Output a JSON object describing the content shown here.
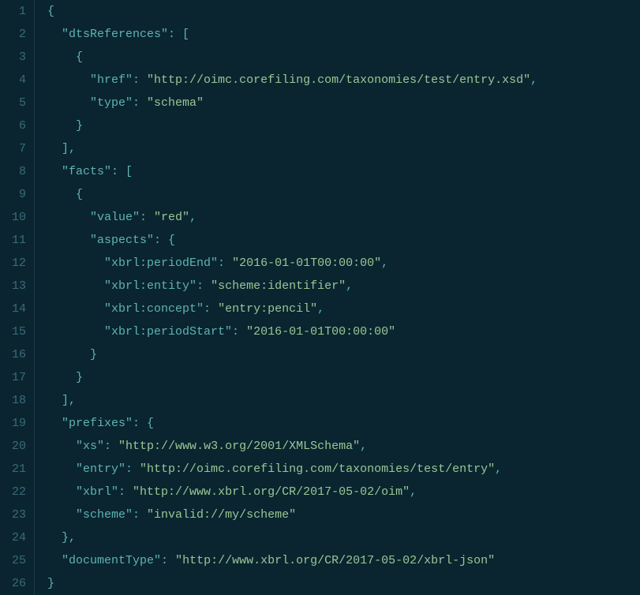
{
  "lineCount": 26,
  "code": {
    "dtsReferences": [
      {
        "href": "http://oimc.corefiling.com/taxonomies/test/entry.xsd",
        "type": "schema"
      }
    ],
    "facts": [
      {
        "value": "red",
        "aspects": {
          "xbrl:periodEnd": "2016-01-01T00:00:00",
          "xbrl:entity": "scheme:identifier",
          "xbrl:concept": "entry:pencil",
          "xbrl:periodStart": "2016-01-01T00:00:00"
        }
      }
    ],
    "prefixes": {
      "xs": "http://www.w3.org/2001/XMLSchema",
      "entry": "http://oimc.corefiling.com/taxonomies/test/entry",
      "xbrl": "http://www.xbrl.org/CR/2017-05-02/oim",
      "scheme": "invalid://my/scheme"
    },
    "documentType": "http://www.xbrl.org/CR/2017-05-02/xbrl-json"
  },
  "tokens": [
    [
      {
        "t": "punct",
        "v": "{"
      }
    ],
    [
      {
        "t": "ind",
        "v": "  "
      },
      {
        "t": "key",
        "v": "\"dtsReferences\""
      },
      {
        "t": "punct",
        "v": ": ["
      }
    ],
    [
      {
        "t": "ind",
        "v": "    "
      },
      {
        "t": "punct",
        "v": "{"
      }
    ],
    [
      {
        "t": "ind",
        "v": "      "
      },
      {
        "t": "key",
        "v": "\"href\""
      },
      {
        "t": "punct",
        "v": ": "
      },
      {
        "t": "str",
        "v": "\"http://oimc.corefiling.com/taxonomies/test/entry.xsd\""
      },
      {
        "t": "punct",
        "v": ","
      }
    ],
    [
      {
        "t": "ind",
        "v": "      "
      },
      {
        "t": "key",
        "v": "\"type\""
      },
      {
        "t": "punct",
        "v": ": "
      },
      {
        "t": "str",
        "v": "\"schema\""
      }
    ],
    [
      {
        "t": "ind",
        "v": "    "
      },
      {
        "t": "punct",
        "v": "}"
      }
    ],
    [
      {
        "t": "ind",
        "v": "  "
      },
      {
        "t": "punct",
        "v": "],"
      }
    ],
    [
      {
        "t": "ind",
        "v": "  "
      },
      {
        "t": "key",
        "v": "\"facts\""
      },
      {
        "t": "punct",
        "v": ": ["
      }
    ],
    [
      {
        "t": "ind",
        "v": "    "
      },
      {
        "t": "punct",
        "v": "{"
      }
    ],
    [
      {
        "t": "ind",
        "v": "      "
      },
      {
        "t": "key",
        "v": "\"value\""
      },
      {
        "t": "punct",
        "v": ": "
      },
      {
        "t": "str",
        "v": "\"red\""
      },
      {
        "t": "punct",
        "v": ","
      }
    ],
    [
      {
        "t": "ind",
        "v": "      "
      },
      {
        "t": "key",
        "v": "\"aspects\""
      },
      {
        "t": "punct",
        "v": ": {"
      }
    ],
    [
      {
        "t": "ind",
        "v": "        "
      },
      {
        "t": "key",
        "v": "\"xbrl:periodEnd\""
      },
      {
        "t": "punct",
        "v": ": "
      },
      {
        "t": "str",
        "v": "\"2016-01-01T00:00:00\""
      },
      {
        "t": "punct",
        "v": ","
      }
    ],
    [
      {
        "t": "ind",
        "v": "        "
      },
      {
        "t": "key",
        "v": "\"xbrl:entity\""
      },
      {
        "t": "punct",
        "v": ": "
      },
      {
        "t": "str",
        "v": "\"scheme:identifier\""
      },
      {
        "t": "punct",
        "v": ","
      }
    ],
    [
      {
        "t": "ind",
        "v": "        "
      },
      {
        "t": "key",
        "v": "\"xbrl:concept\""
      },
      {
        "t": "punct",
        "v": ": "
      },
      {
        "t": "str",
        "v": "\"entry:pencil\""
      },
      {
        "t": "punct",
        "v": ","
      }
    ],
    [
      {
        "t": "ind",
        "v": "        "
      },
      {
        "t": "key",
        "v": "\"xbrl:periodStart\""
      },
      {
        "t": "punct",
        "v": ": "
      },
      {
        "t": "str",
        "v": "\"2016-01-01T00:00:00\""
      }
    ],
    [
      {
        "t": "ind",
        "v": "      "
      },
      {
        "t": "punct",
        "v": "}"
      }
    ],
    [
      {
        "t": "ind",
        "v": "    "
      },
      {
        "t": "punct",
        "v": "}"
      }
    ],
    [
      {
        "t": "ind",
        "v": "  "
      },
      {
        "t": "punct",
        "v": "],"
      }
    ],
    [
      {
        "t": "ind",
        "v": "  "
      },
      {
        "t": "key",
        "v": "\"prefixes\""
      },
      {
        "t": "punct",
        "v": ": {"
      }
    ],
    [
      {
        "t": "ind",
        "v": "    "
      },
      {
        "t": "key",
        "v": "\"xs\""
      },
      {
        "t": "punct",
        "v": ": "
      },
      {
        "t": "str",
        "v": "\"http://www.w3.org/2001/XMLSchema\""
      },
      {
        "t": "punct",
        "v": ","
      }
    ],
    [
      {
        "t": "ind",
        "v": "    "
      },
      {
        "t": "key",
        "v": "\"entry\""
      },
      {
        "t": "punct",
        "v": ": "
      },
      {
        "t": "str",
        "v": "\"http://oimc.corefiling.com/taxonomies/test/entry\""
      },
      {
        "t": "punct",
        "v": ","
      }
    ],
    [
      {
        "t": "ind",
        "v": "    "
      },
      {
        "t": "key",
        "v": "\"xbrl\""
      },
      {
        "t": "punct",
        "v": ": "
      },
      {
        "t": "str",
        "v": "\"http://www.xbrl.org/CR/2017-05-02/oim\""
      },
      {
        "t": "punct",
        "v": ","
      }
    ],
    [
      {
        "t": "ind",
        "v": "    "
      },
      {
        "t": "key",
        "v": "\"scheme\""
      },
      {
        "t": "punct",
        "v": ": "
      },
      {
        "t": "str",
        "v": "\"invalid://my/scheme\""
      }
    ],
    [
      {
        "t": "ind",
        "v": "  "
      },
      {
        "t": "punct",
        "v": "},"
      }
    ],
    [
      {
        "t": "ind",
        "v": "  "
      },
      {
        "t": "key",
        "v": "\"documentType\""
      },
      {
        "t": "punct",
        "v": ": "
      },
      {
        "t": "str",
        "v": "\"http://www.xbrl.org/CR/2017-05-02/xbrl-json\""
      }
    ],
    [
      {
        "t": "punct",
        "v": "}"
      }
    ]
  ]
}
